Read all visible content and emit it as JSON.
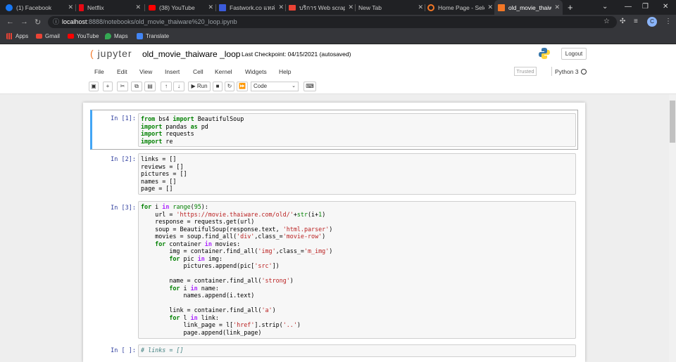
{
  "browser": {
    "tabs": [
      {
        "title": "(1) Facebook",
        "color": "#1877f2"
      },
      {
        "title": "Netflix",
        "color": "#e50914"
      },
      {
        "title": "(38) YouTube",
        "color": "#ff0000"
      },
      {
        "title": "Fastwork.co แหล่งร",
        "color": "#3b5bdb"
      },
      {
        "title": "บริการ Web scrapi",
        "color": "#ea4335"
      },
      {
        "title": "New Tab",
        "color": ""
      },
      {
        "title": "Home Page - Sele",
        "color": "#f37726"
      },
      {
        "title": "old_movie_thaiwa",
        "color": "#f37726"
      }
    ],
    "new_tab": "+",
    "url_host": "localhost",
    "url_path": ":8888/notebooks/old_movie_thaiware%20_loop.ipynb",
    "profile_initial": "C",
    "bookmarks": [
      "Apps",
      "Gmail",
      "YouTube",
      "Maps",
      "Translate"
    ]
  },
  "jupyter": {
    "logo_text": "jupyter",
    "notebook_name": "old_movie_thaiware _loop",
    "checkpoint": "Last Checkpoint: 04/15/2021  (autosaved)",
    "logout": "Logout",
    "menus": [
      "File",
      "Edit",
      "View",
      "Insert",
      "Cell",
      "Kernel",
      "Widgets",
      "Help"
    ],
    "trusted": "Trusted",
    "kernel": "Python 3",
    "run_label": "Run",
    "cell_type": "Code"
  },
  "cells": [
    {
      "prompt": "In [1]:"
    },
    {
      "prompt": "In [2]:"
    },
    {
      "prompt": "In [3]:"
    },
    {
      "prompt": "In [ ]:"
    }
  ]
}
